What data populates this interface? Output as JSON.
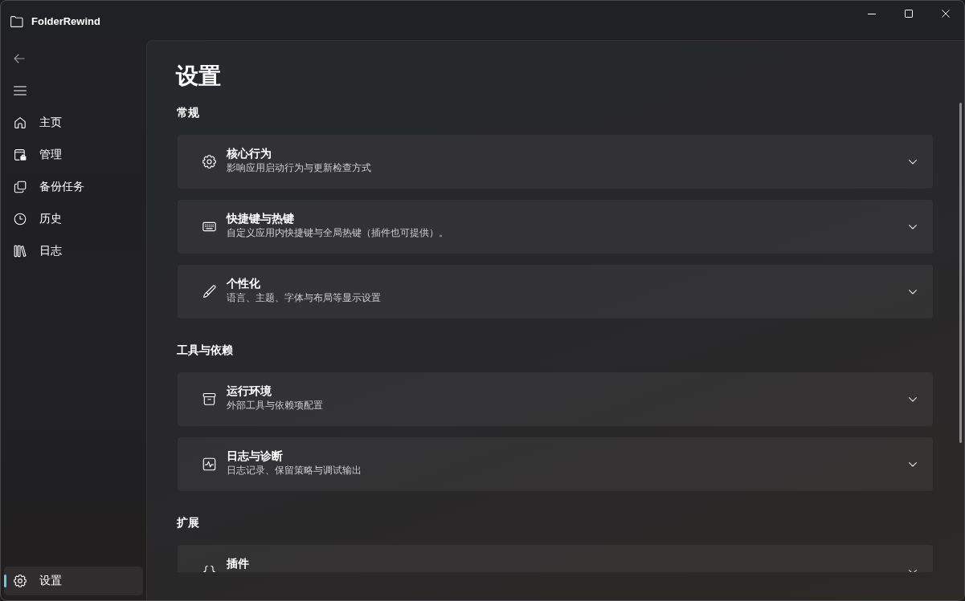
{
  "window": {
    "title": "FolderRewind",
    "controls": [
      {
        "kind": "minimize"
      },
      {
        "kind": "maximize"
      },
      {
        "kind": "close"
      }
    ]
  },
  "sidebar": {
    "top_buttons": [
      {
        "kind": "back",
        "disabled": true
      },
      {
        "kind": "menu",
        "disabled": false
      }
    ],
    "items": [
      {
        "kind": "home",
        "label": "主页",
        "selected": false
      },
      {
        "kind": "manage",
        "label": "管理",
        "selected": false
      },
      {
        "kind": "copy",
        "label": "备份任务",
        "selected": false
      },
      {
        "kind": "clock",
        "label": "历史",
        "selected": false
      },
      {
        "kind": "books",
        "label": "日志",
        "selected": false
      }
    ],
    "footer_items": [
      {
        "kind": "gear",
        "label": "设置",
        "selected": true
      }
    ]
  },
  "page": {
    "title": "设置",
    "sections": [
      {
        "heading": "常规",
        "cards": [
          {
            "kind": "gear",
            "title": "核心行为",
            "description": "影响应用启动行为与更新检查方式",
            "expanded": false
          },
          {
            "kind": "keyboard",
            "title": "快捷键与热键",
            "description": "自定义应用内快捷键与全局热键（插件也可提供）。",
            "expanded": false
          },
          {
            "kind": "pen",
            "title": "个性化",
            "description": "语言、主题、字体与布局等显示设置",
            "expanded": false
          }
        ]
      },
      {
        "heading": "工具与依赖",
        "cards": [
          {
            "kind": "archive",
            "title": "运行环境",
            "description": "外部工具与依赖项配置",
            "expanded": false
          },
          {
            "kind": "pulse",
            "title": "日志与诊断",
            "description": "日志记录、保留策略与调试输出",
            "expanded": false
          }
        ]
      },
      {
        "heading": "扩展",
        "cards": [
          {
            "kind": "braces",
            "title": "插件",
            "expanded": false
          }
        ]
      }
    ]
  }
}
